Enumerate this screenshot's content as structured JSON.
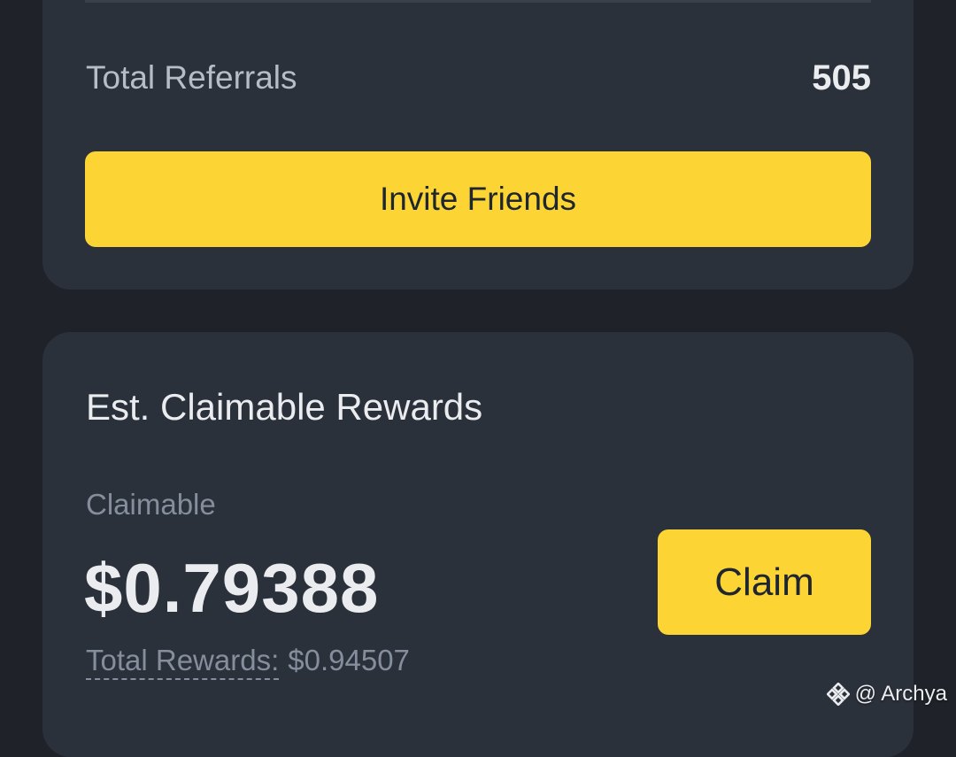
{
  "referrals": {
    "label": "Total Referrals",
    "value": "505",
    "invite_button": "Invite Friends"
  },
  "rewards": {
    "title": "Est. Claimable Rewards",
    "claimable_label": "Claimable",
    "claimable_value": "$0.79388",
    "total_label": "Total Rewards:",
    "total_value": "$0.94507",
    "claim_button": "Claim"
  },
  "watermark": {
    "text": "@ Archya",
    "icon": "binance-logo-icon"
  },
  "colors": {
    "accent": "#fcd535",
    "background": "#1f2329",
    "card": "#2b313b",
    "text_primary": "#eaecef",
    "text_secondary": "#848e9c"
  }
}
